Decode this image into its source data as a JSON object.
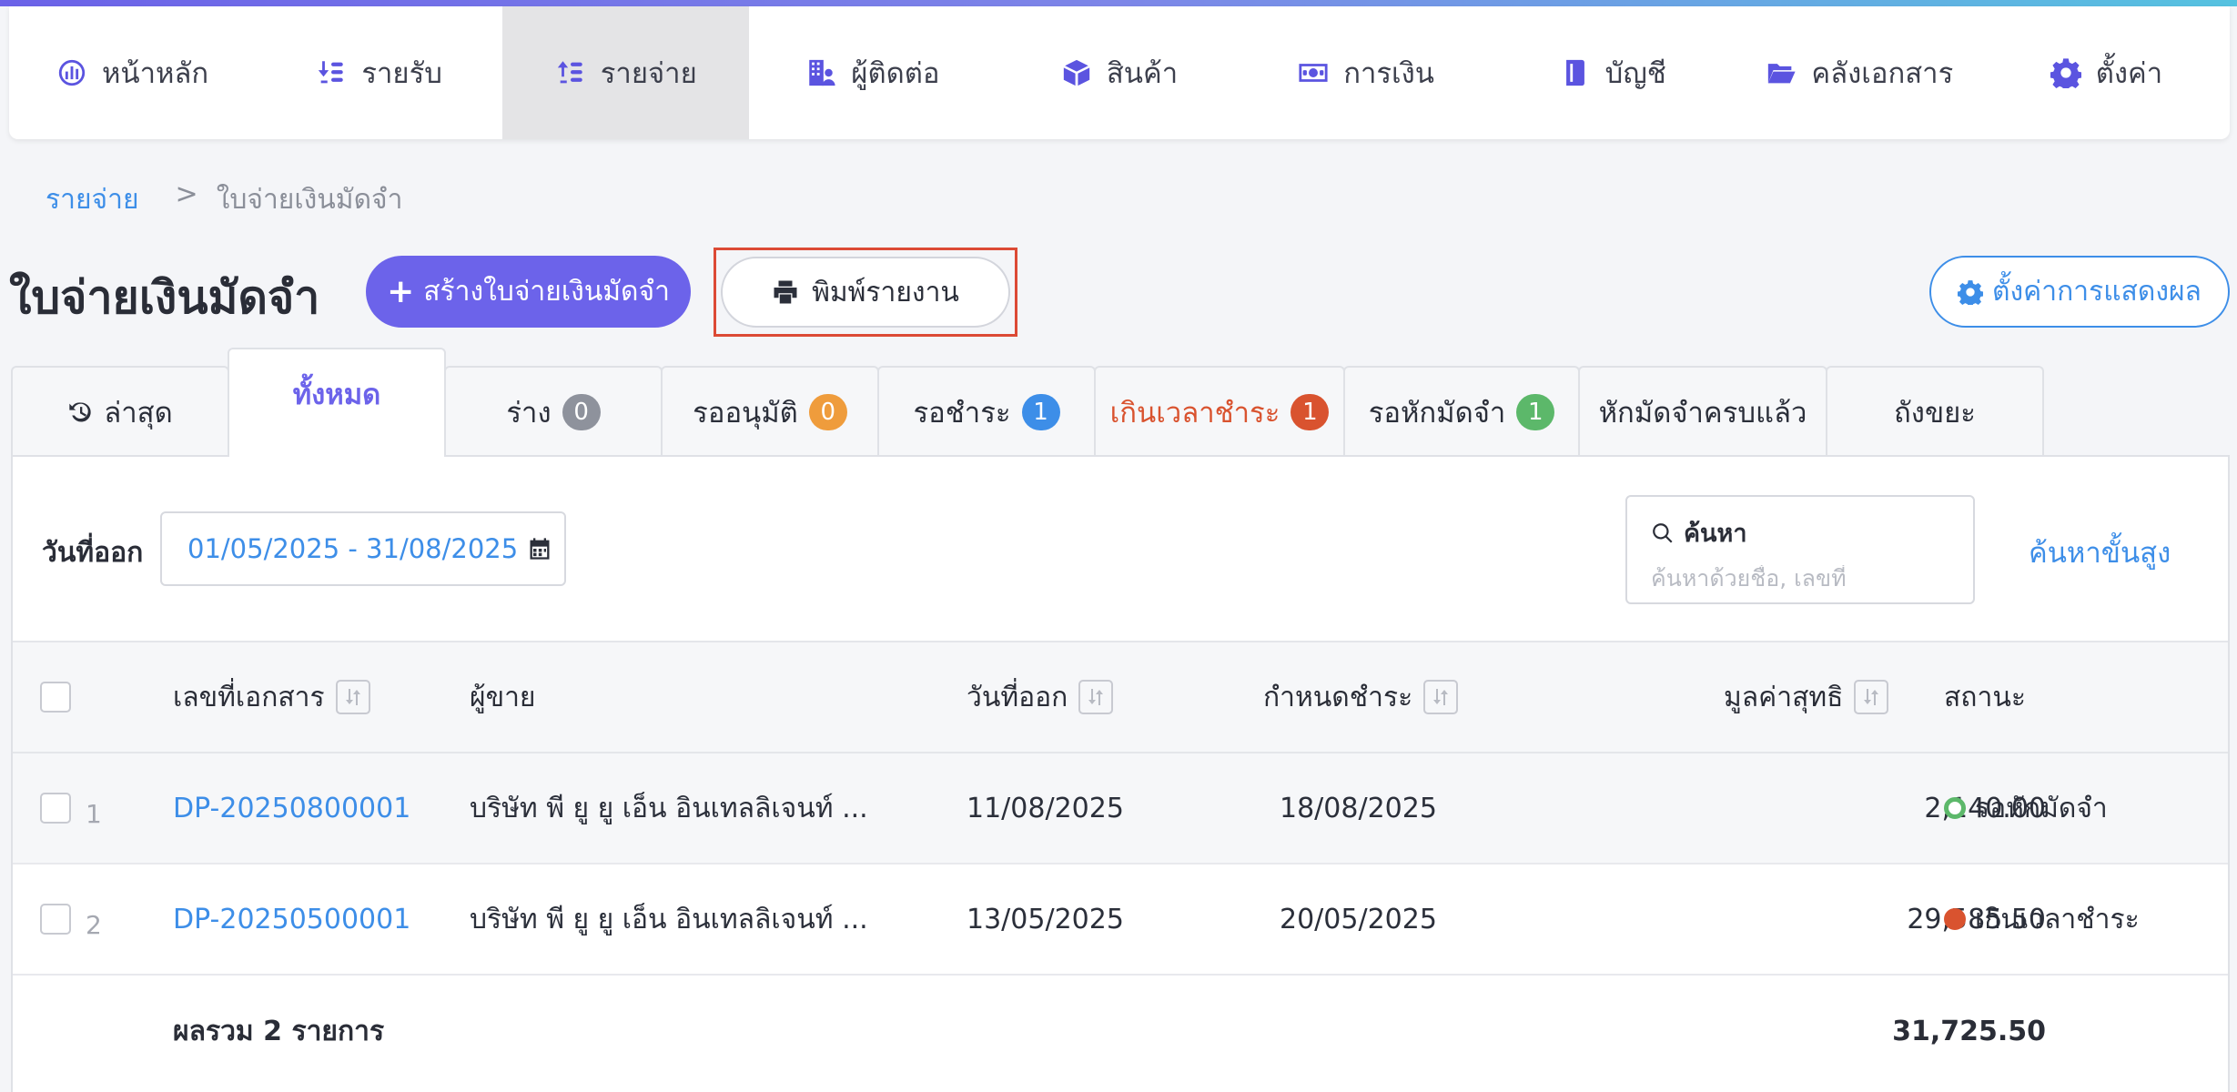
{
  "nav": {
    "items": [
      {
        "label": "หน้าหลัก",
        "icon": "dashboard-icon"
      },
      {
        "label": "รายรับ",
        "icon": "income-icon"
      },
      {
        "label": "รายจ่าย",
        "icon": "expense-icon"
      },
      {
        "label": "ผู้ติดต่อ",
        "icon": "contacts-icon"
      },
      {
        "label": "สินค้า",
        "icon": "product-box-icon"
      },
      {
        "label": "การเงิน",
        "icon": "money-icon"
      },
      {
        "label": "บัญชี",
        "icon": "accounting-book-icon"
      },
      {
        "label": "คลังเอกสาร",
        "icon": "folder-icon"
      },
      {
        "label": "ตั้งค่า",
        "icon": "gear-icon"
      }
    ],
    "active_index": 2
  },
  "breadcrumb": {
    "parent": "รายจ่าย",
    "separator": ">",
    "current": "ใบจ่ายเงินมัดจำ"
  },
  "page": {
    "title": "ใบจ่ายเงินมัดจำ",
    "create_plus": "+",
    "create_label": "สร้างใบจ่ายเงินมัดจำ",
    "print_label": "พิมพ์รายงาน",
    "display_settings_label": "ตั้งค่าการแสดงผล"
  },
  "tabs": [
    {
      "label": "ล่าสุด",
      "badge": null,
      "icon": "history-icon"
    },
    {
      "label": "ทั้งหมด",
      "badge": null
    },
    {
      "label": "ร่าง",
      "badge": "0",
      "badge_color": "#8e929c"
    },
    {
      "label": "รออนุมัติ",
      "badge": "0",
      "badge_color": "#ef9c3c"
    },
    {
      "label": "รอชำระ",
      "badge": "1",
      "badge_color": "#3d8ee8"
    },
    {
      "label": "เกินเวลาชำระ",
      "badge": "1",
      "badge_color": "#d9532f"
    },
    {
      "label": "รอหักมัดจำ",
      "badge": "1",
      "badge_color": "#5cb86a"
    },
    {
      "label": "หักมัดจำครบแล้ว",
      "badge": null
    },
    {
      "label": "ถังขยะ",
      "badge": null
    }
  ],
  "filters": {
    "date_label": "วันที่ออก",
    "date_range": "01/05/2025 - 31/08/2025",
    "search_title": "ค้นหา",
    "search_placeholder": "ค้นหาด้วยชื่อ, เลขที่",
    "search_value": "",
    "advanced_search": "ค้นหาขั้นสูง"
  },
  "table": {
    "headers": {
      "doc_no": "เลขที่เอกสาร",
      "vendor": "ผู้ขาย",
      "issue_date": "วันที่ออก",
      "due_date": "กำหนดชำระ",
      "net_amount": "มูลค่าสุทธิ",
      "status": "สถานะ"
    },
    "rows": [
      {
        "index": "1",
        "doc_no": "DP-20250800001",
        "vendor": "บริษัท พี ยู ยู เอ็น อินเทลลิเจนท์ ...",
        "issue_date": "11/08/2025",
        "due_date": "18/08/2025",
        "net_amount": "2,140.00",
        "status": "รอหักมัดจำ",
        "status_color": "#5cb86a"
      },
      {
        "index": "2",
        "doc_no": "DP-20250500001",
        "vendor": "บริษัท พี ยู ยู เอ็น อินเทลลิเจนท์ ...",
        "issue_date": "13/05/2025",
        "due_date": "20/05/2025",
        "net_amount": "29,585.50",
        "status": "เกินเวลาชำระ",
        "status_color": "#d9532f"
      }
    ],
    "summary_label": "ผลรวม 2 รายการ",
    "summary_total": "31,725.50"
  },
  "colors": {
    "accent": "#6c63ea",
    "link": "#3d8ee8",
    "highlight_box": "#dc4a35"
  }
}
